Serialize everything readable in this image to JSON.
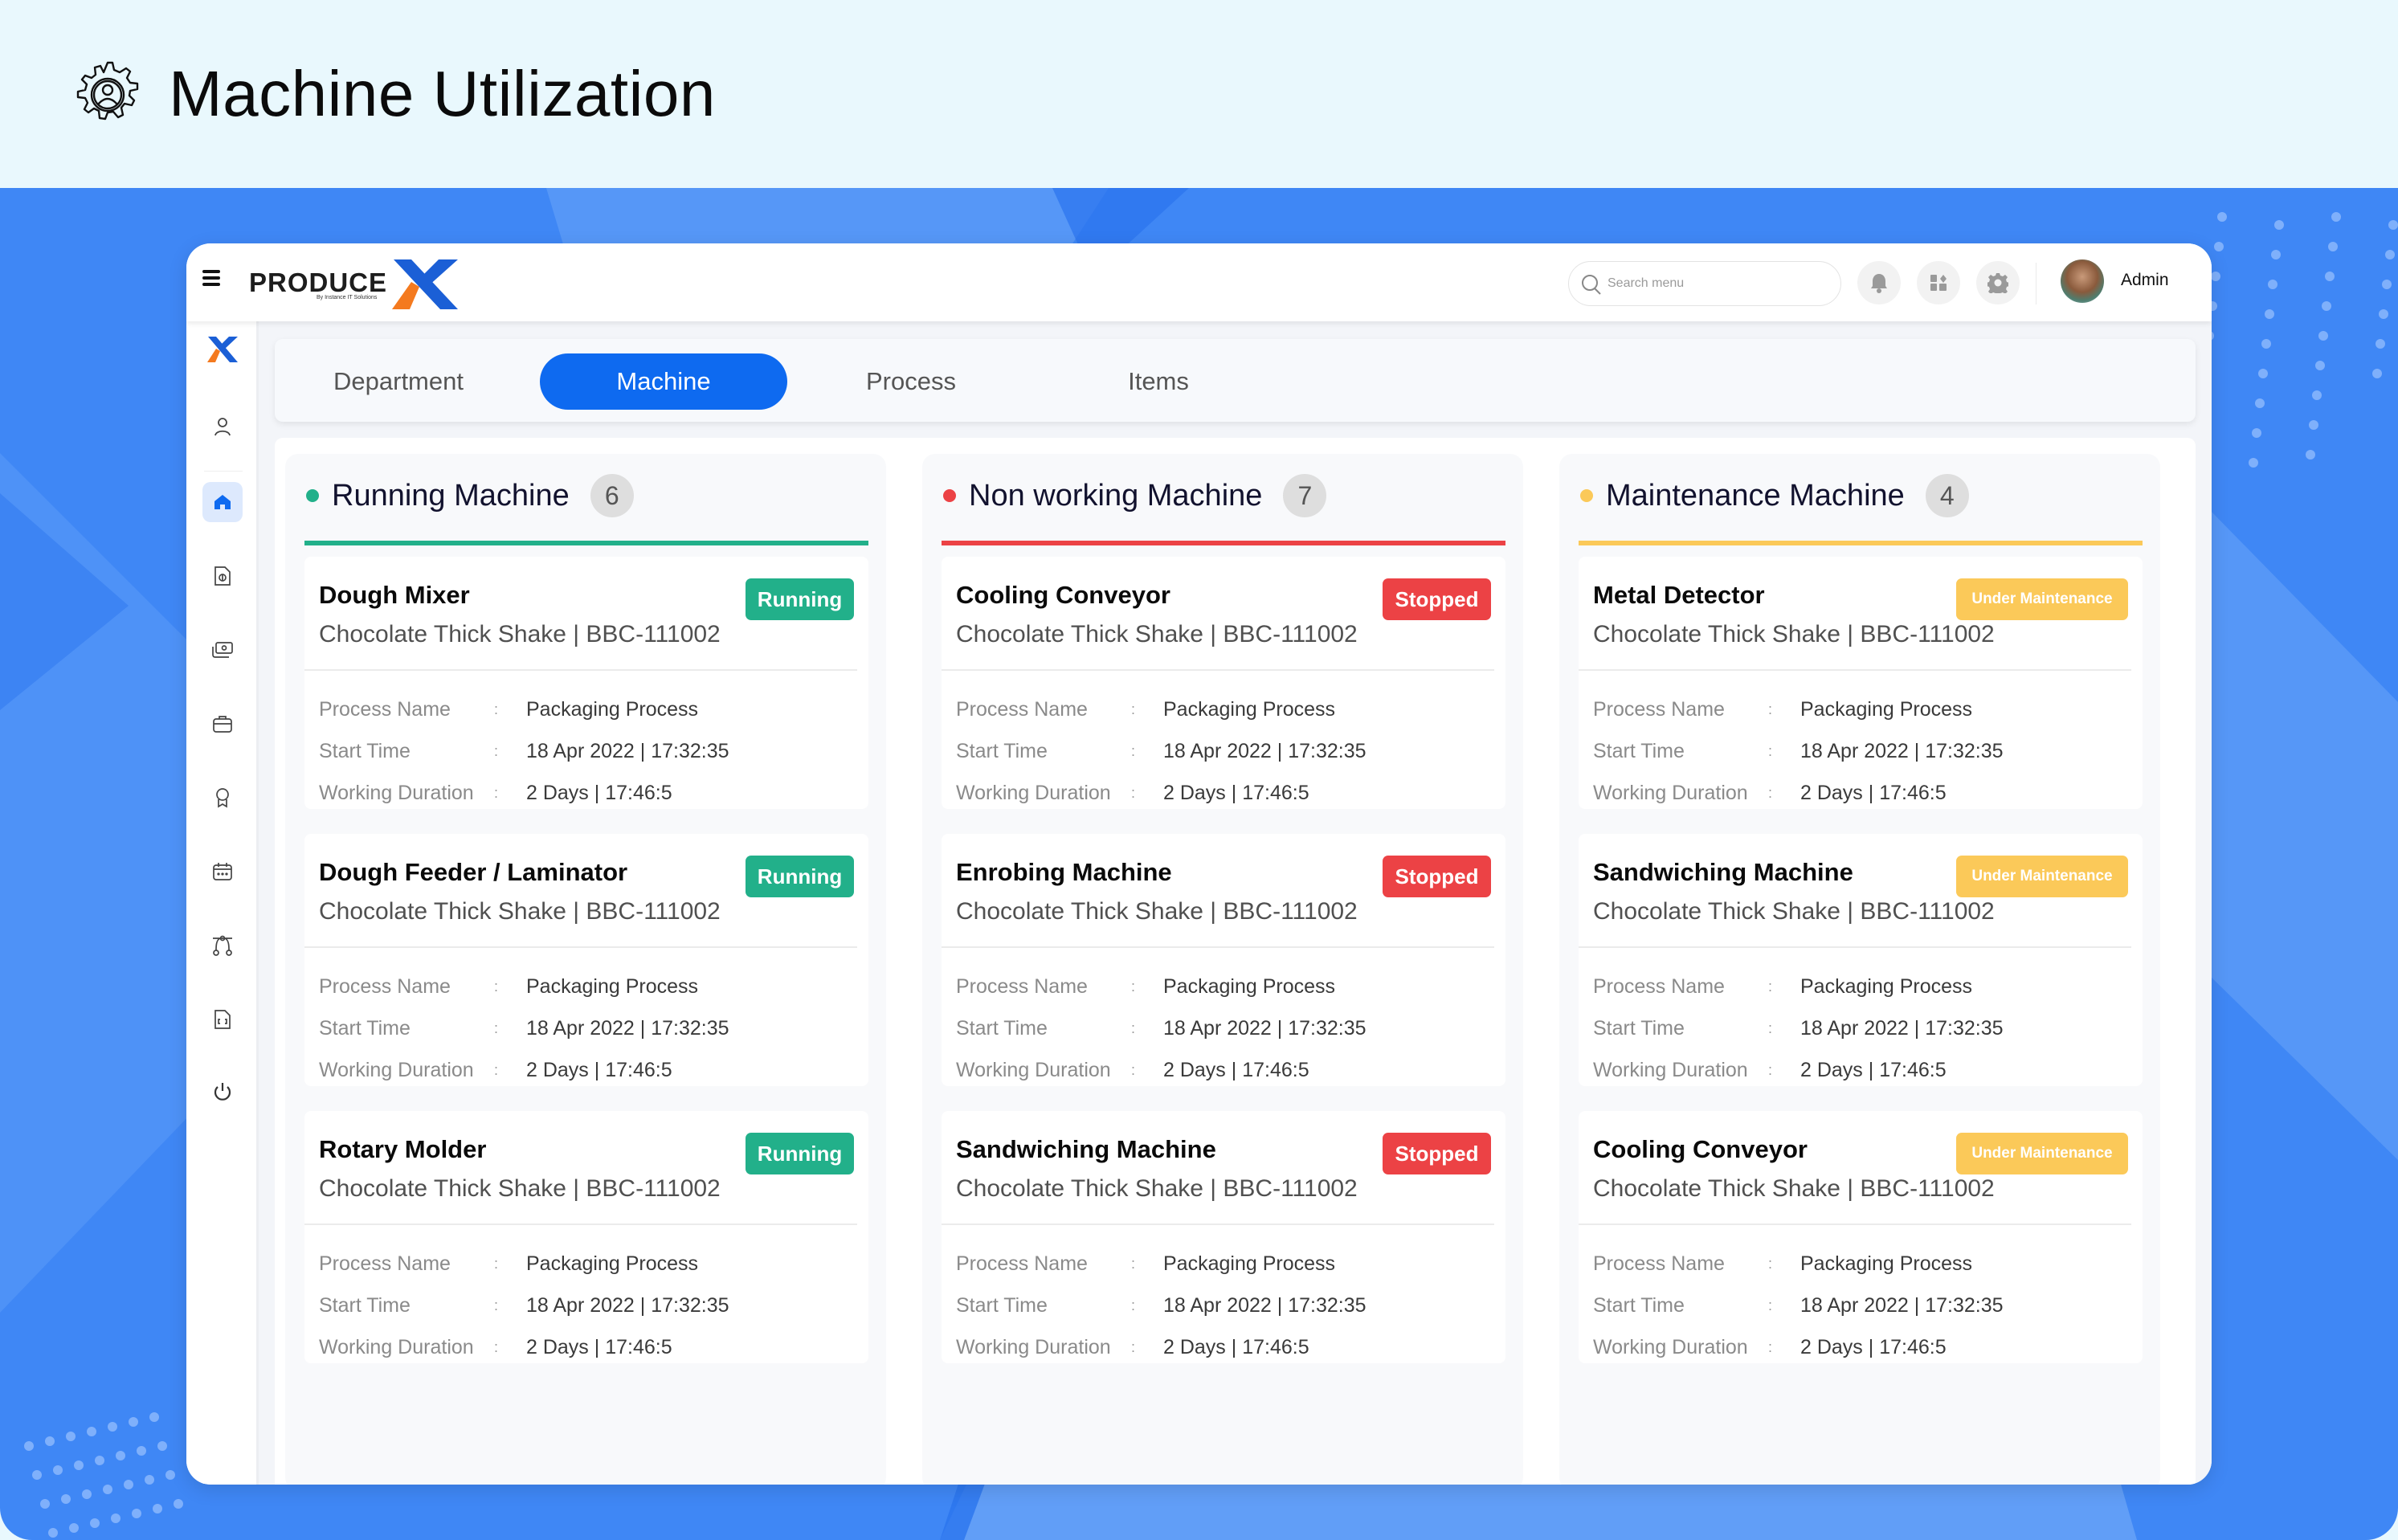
{
  "page": {
    "title": "Machine Utilization",
    "title_icon": "gear-person-icon"
  },
  "app": {
    "brand": "PRODUCE",
    "brand_mark": "X",
    "brand_tagline": "By Instance IT Solutions",
    "search": {
      "placeholder": "Search menu",
      "value": ""
    },
    "top_icons": [
      "bell-icon",
      "apps-icon",
      "settings-icon"
    ],
    "user": {
      "name": "Admin"
    }
  },
  "sidebar": {
    "items": [
      {
        "icon": "logo-x-icon"
      },
      {
        "icon": "user-icon"
      },
      {
        "icon": "home-icon",
        "active": true
      },
      {
        "icon": "document-dollar-icon"
      },
      {
        "icon": "money-icon"
      },
      {
        "icon": "briefcase-icon"
      },
      {
        "icon": "award-icon"
      },
      {
        "icon": "calendar-icon"
      },
      {
        "icon": "vector-nodes-icon"
      },
      {
        "icon": "file-code-icon"
      },
      {
        "icon": "power-icon"
      }
    ]
  },
  "tabs": [
    {
      "label": "Department",
      "active": false
    },
    {
      "label": "Machine",
      "active": true
    },
    {
      "label": "Process",
      "active": false
    },
    {
      "label": "Items",
      "active": false
    }
  ],
  "field_labels": {
    "process": "Process Name",
    "start": "Start Time",
    "duration": "Working Duration",
    "separator": ":"
  },
  "columns": [
    {
      "title": "Running Machine",
      "count": "6",
      "color": "#22b08a",
      "cards": [
        {
          "name": "Dough Mixer",
          "product": "Chocolate Thick Shake | BBC-111002",
          "status": "Running",
          "process": "Packaging Process",
          "start": "18 Apr 2022 | 17:32:35",
          "duration": "2 Days | 17:46:5"
        },
        {
          "name": "Dough Feeder / Laminator",
          "product": "Chocolate Thick Shake | BBC-111002",
          "status": "Running",
          "process": "Packaging Process",
          "start": "18 Apr 2022 | 17:32:35",
          "duration": "2 Days | 17:46:5"
        },
        {
          "name": "Rotary Molder",
          "product": "Chocolate Thick Shake | BBC-111002",
          "status": "Running",
          "process": "Packaging Process",
          "start": "18 Apr 2022 | 17:32:35",
          "duration": "2 Days | 17:46:5"
        }
      ]
    },
    {
      "title": "Non working Machine",
      "count": "7",
      "color": "#ec4245",
      "cards": [
        {
          "name": "Cooling Conveyor",
          "product": "Chocolate Thick Shake | BBC-111002",
          "status": "Stopped",
          "process": "Packaging Process",
          "start": "18 Apr 2022 | 17:32:35",
          "duration": "2 Days | 17:46:5"
        },
        {
          "name": "Enrobing Machine",
          "product": "Chocolate Thick Shake | BBC-111002",
          "status": "Stopped",
          "process": "Packaging Process",
          "start": "18 Apr 2022 | 17:32:35",
          "duration": "2 Days | 17:46:5"
        },
        {
          "name": "Sandwiching Machine",
          "product": "Chocolate Thick Shake | BBC-111002",
          "status": "Stopped",
          "process": "Packaging Process",
          "start": "18 Apr 2022 | 17:32:35",
          "duration": "2 Days | 17:46:5"
        }
      ]
    },
    {
      "title": "Maintenance Machine",
      "count": "4",
      "color": "#fbc959",
      "cards": [
        {
          "name": "Metal Detector",
          "product": "Chocolate Thick Shake | BBC-111002",
          "status": "Under Maintenance",
          "process": "Packaging Process",
          "start": "18 Apr 2022 | 17:32:35",
          "duration": "2 Days | 17:46:5"
        },
        {
          "name": "Sandwiching Machine",
          "product": "Chocolate Thick Shake | BBC-111002",
          "status": "Under Maintenance",
          "process": "Packaging Process",
          "start": "18 Apr 2022 | 17:32:35",
          "duration": "2 Days | 17:46:5"
        },
        {
          "name": "Cooling Conveyor",
          "product": "Chocolate Thick Shake | BBC-111002",
          "status": "Under Maintenance",
          "process": "Packaging Process",
          "start": "18 Apr 2022 | 17:32:35",
          "duration": "2 Days | 17:46:5"
        }
      ]
    }
  ],
  "colors": {
    "accent": "#0e6af0",
    "running": "#22b08a",
    "stopped": "#ec4245",
    "maintenance": "#fbc959",
    "header_bg": "#e9f8fd",
    "page_bg": "#3f87f5"
  }
}
